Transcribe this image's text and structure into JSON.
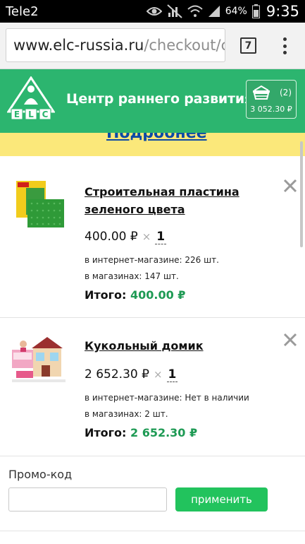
{
  "status_bar": {
    "carrier": "Tele2",
    "battery_percent": "64%",
    "time": "9:35"
  },
  "browser": {
    "url_domain": "www.elc-russia.ru",
    "url_path": "/checkout/cart/",
    "tab_count": "7"
  },
  "header": {
    "logo_letters": [
      "E",
      "L",
      "C"
    ],
    "site_title": "Центр раннего развития",
    "cart_count": "(2)",
    "cart_total": "3 052.30 ₽",
    "brand_color": "#2cb56f"
  },
  "banner": {
    "link_text": "Подробнее"
  },
  "cart_items": [
    {
      "name": "Строительная пластина зеленого цвета",
      "price": "400.00 ₽",
      "times": "×",
      "quantity": "1",
      "stock_online": "в интернет-магазине: 226 шт.",
      "stock_stores": "в магазинах: 147 шт.",
      "total_label": "Итого:",
      "total_value": "400.00 ₽",
      "remove_icon": "close-icon"
    },
    {
      "name": "Кукольный домик",
      "price": "2 652.30 ₽",
      "times": "×",
      "quantity": "1",
      "stock_online": "в интернет-магазине: Нет в наличии",
      "stock_stores": "в магазинах: 2 шт.",
      "total_label": "Итого:",
      "total_value": "2 652.30 ₽",
      "remove_icon": "close-icon"
    }
  ],
  "promo": {
    "label": "Промо-код",
    "input_value": "",
    "apply_label": "применить"
  }
}
